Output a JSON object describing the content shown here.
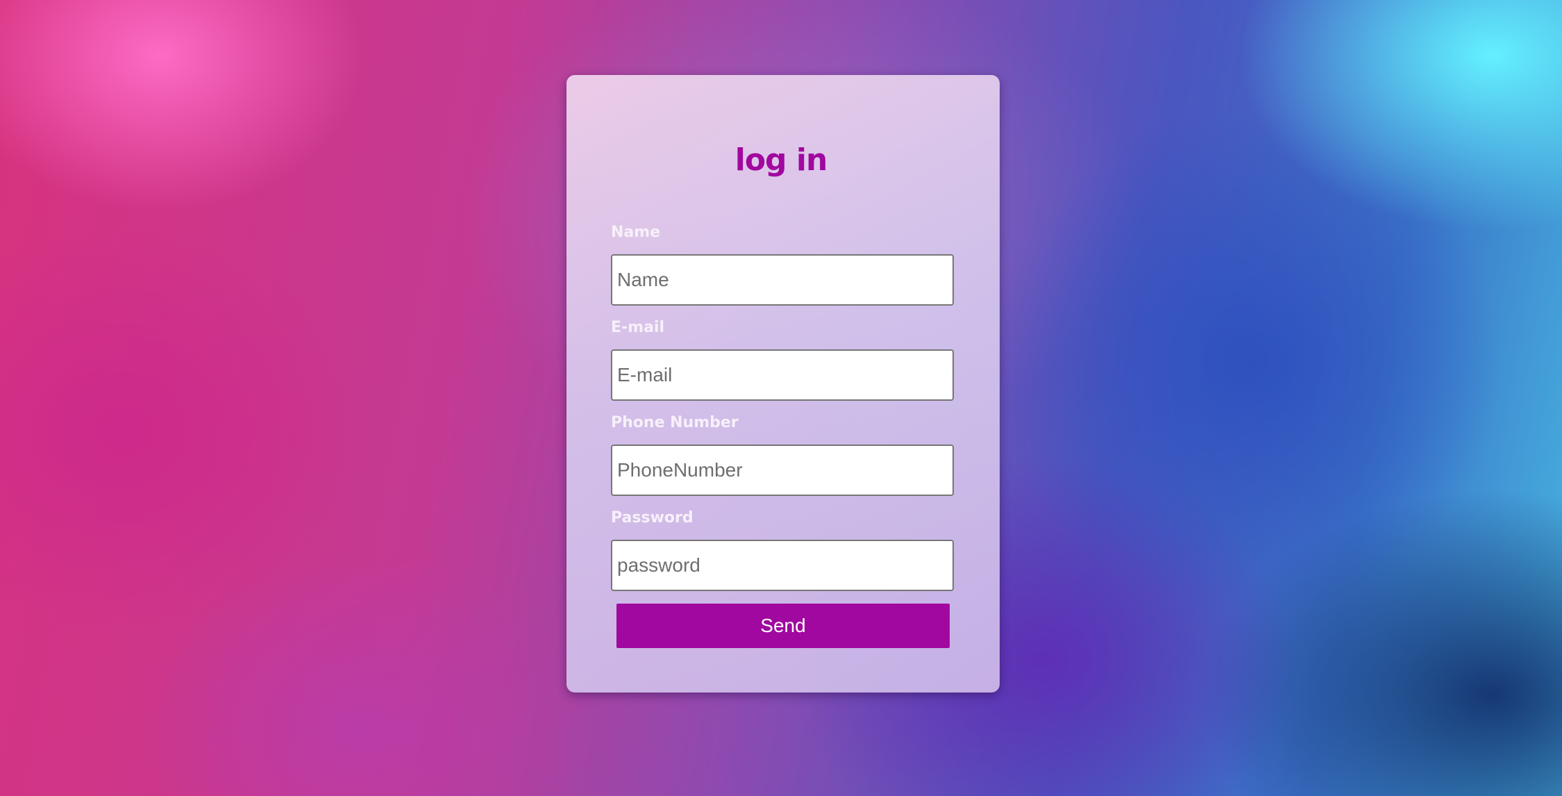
{
  "form": {
    "title": "log in",
    "fields": [
      {
        "label": "Name",
        "placeholder": "Name",
        "value": ""
      },
      {
        "label": "E-mail",
        "placeholder": "E-mail",
        "value": ""
      },
      {
        "label": "Phone Number",
        "placeholder": "PhoneNumber",
        "value": ""
      },
      {
        "label": "Password",
        "placeholder": "password",
        "value": ""
      }
    ],
    "submit_label": "Send"
  },
  "colors": {
    "accent": "#a0089f",
    "label_text": "#f7f0fa",
    "card_tint": "#e4cdea"
  }
}
